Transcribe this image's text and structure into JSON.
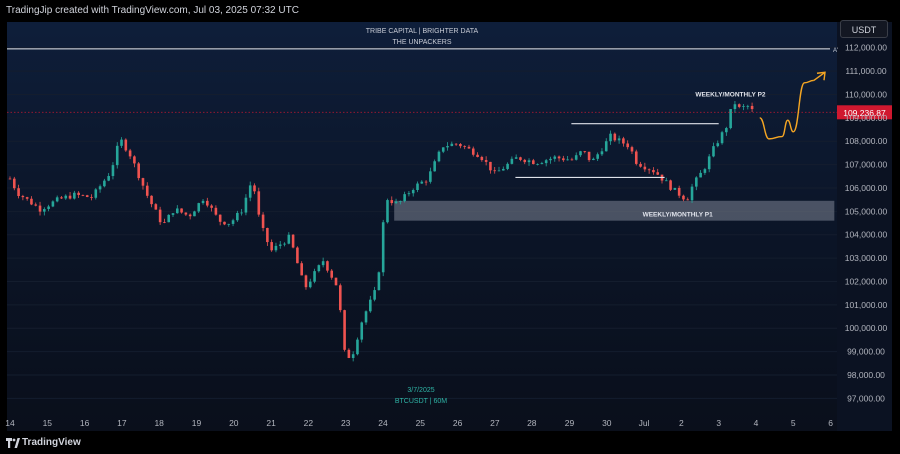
{
  "header": {
    "credit": "TradingJip created with TradingView.com, Jul 03, 2025 07:32 UTC"
  },
  "currency_button": "USDT",
  "footer": {
    "brand": "TradingView"
  },
  "colors": {
    "up": "#26a69a",
    "down": "#ef5350",
    "background": "#0c1526",
    "zone": "#7d8593",
    "arrow": "#f5a623",
    "price_tag": "#d0182f"
  },
  "chart_data": {
    "type": "candlestick",
    "symbol": "BTCUSDT | 60M",
    "date_label": "3/7/2025",
    "watermark": [
      "TRIBE CAPITAL | BRIGHTER DATA",
      "THE UNPACKERS"
    ],
    "y_ticks": [
      "112,000.00",
      "111,000.00",
      "110,000.00",
      "109,000.00",
      "108,000.00",
      "107,000.00",
      "106,000.00",
      "105,000.00",
      "104,000.00",
      "103,000.00",
      "102,000.00",
      "101,000.00",
      "100,000.00",
      "99,000.00",
      "98,000.00",
      "97,000.00"
    ],
    "y_tick_values": [
      112000,
      111000,
      110000,
      109000,
      108000,
      107000,
      106000,
      105000,
      104000,
      103000,
      102000,
      101000,
      100000,
      99000,
      98000,
      97000
    ],
    "ylim": [
      96500,
      113100
    ],
    "x_ticks": [
      "14",
      "15",
      "16",
      "17",
      "18",
      "19",
      "20",
      "21",
      "22",
      "23",
      "24",
      "25",
      "26",
      "27",
      "28",
      "29",
      "30",
      "Jul",
      "2",
      "3",
      "4",
      "5",
      "6"
    ],
    "x_tick_day_index": [
      0,
      1,
      2,
      3,
      4,
      5,
      6,
      7,
      8,
      9,
      10,
      11,
      12,
      13,
      13.99,
      15,
      16,
      17,
      18,
      19,
      20,
      21,
      22
    ],
    "last_price": "109,236.87",
    "last_price_value": 109236.87,
    "horizontal_line": {
      "value": 111950,
      "label": "A'"
    },
    "support_zone": {
      "label": "WEEKLY/MONTHLY P1",
      "from_day": 10.3,
      "to_day": 22.1,
      "low": 104600,
      "high": 105450
    },
    "resistance_label": {
      "text": "WEEKLY/MONTHLY P2",
      "day": 19.1,
      "value": 110000
    },
    "range_lines": [
      {
        "from_day": 15.05,
        "to_day": 19.0,
        "value": 108750
      },
      {
        "from_day": 13.55,
        "to_day": 17.55,
        "value": 106450
      }
    ],
    "path_key_points": [
      [
        0,
        106400
      ],
      [
        0.2,
        105800
      ],
      [
        0.8,
        105100
      ],
      [
        1.3,
        105500
      ],
      [
        1.7,
        105700
      ],
      [
        2.2,
        105600
      ],
      [
        2.7,
        106700
      ],
      [
        2.95,
        108100
      ],
      [
        3.2,
        107500
      ],
      [
        3.7,
        105600
      ],
      [
        4.1,
        104400
      ],
      [
        4.4,
        105100
      ],
      [
        4.8,
        104800
      ],
      [
        5.2,
        105600
      ],
      [
        5.6,
        104600
      ],
      [
        5.9,
        104500
      ],
      [
        6.2,
        105000
      ],
      [
        6.5,
        106400
      ],
      [
        6.7,
        104500
      ],
      [
        7.0,
        103300
      ],
      [
        7.5,
        103900
      ],
      [
        7.9,
        101700
      ],
      [
        8.4,
        102900
      ],
      [
        8.8,
        101700
      ],
      [
        8.95,
        99000
      ],
      [
        9.15,
        98700
      ],
      [
        9.45,
        100400
      ],
      [
        9.8,
        101600
      ],
      [
        9.95,
        103100
      ],
      [
        10.05,
        105600
      ],
      [
        10.4,
        105300
      ],
      [
        10.8,
        106000
      ],
      [
        11.2,
        106400
      ],
      [
        11.6,
        107800
      ],
      [
        12.0,
        107900
      ],
      [
        12.6,
        107400
      ],
      [
        13.0,
        106600
      ],
      [
        13.6,
        107300
      ],
      [
        14.1,
        107100
      ],
      [
        14.6,
        107300
      ],
      [
        15.1,
        107200
      ],
      [
        15.35,
        107600
      ],
      [
        15.6,
        107100
      ],
      [
        16.1,
        108200
      ],
      [
        16.6,
        107800
      ],
      [
        16.8,
        107100
      ],
      [
        17.3,
        106700
      ],
      [
        17.8,
        105900
      ],
      [
        18.15,
        105500
      ],
      [
        18.3,
        106100
      ],
      [
        18.6,
        106800
      ],
      [
        18.9,
        107800
      ],
      [
        19.2,
        108600
      ],
      [
        19.4,
        109700
      ],
      [
        19.55,
        109400
      ],
      [
        19.8,
        109500
      ],
      [
        20.0,
        109100
      ]
    ],
    "projection": [
      [
        20.1,
        109000
      ],
      [
        20.35,
        108100
      ],
      [
        20.7,
        108200
      ],
      [
        20.85,
        108900
      ],
      [
        21.0,
        108400
      ],
      [
        21.3,
        110500
      ],
      [
        21.55,
        110600
      ]
    ]
  }
}
